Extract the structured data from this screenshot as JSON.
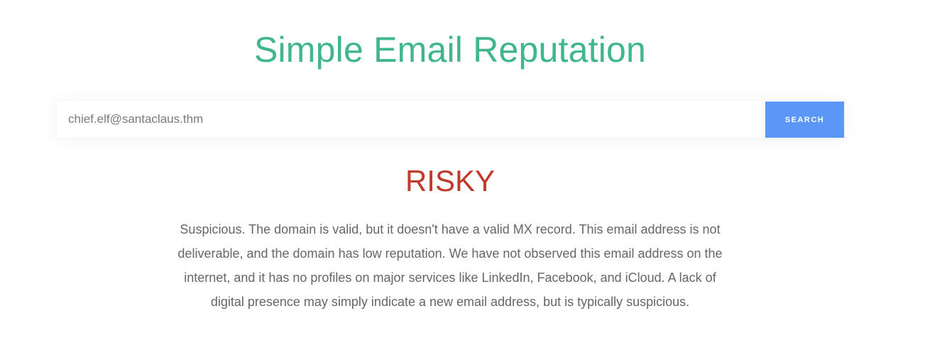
{
  "header": {
    "title": "Simple Email Reputation"
  },
  "search": {
    "value": "chief.elf@santaclaus.thm",
    "button_label": "SEARCH"
  },
  "result": {
    "verdict": "RISKY",
    "description": "Suspicious. The domain is valid, but it doesn't have a valid MX record. This email address is not deliverable, and the domain has low reputation. We have not observed this email address on the internet, and it has no profiles on major services like LinkedIn, Facebook, and iCloud. A lack of digital presence may simply indicate a new email address, but is typically suspicious."
  },
  "colors": {
    "title": "#3fb68c",
    "button": "#5b97f7",
    "verdict": "#c0392b",
    "text": "#666666"
  }
}
